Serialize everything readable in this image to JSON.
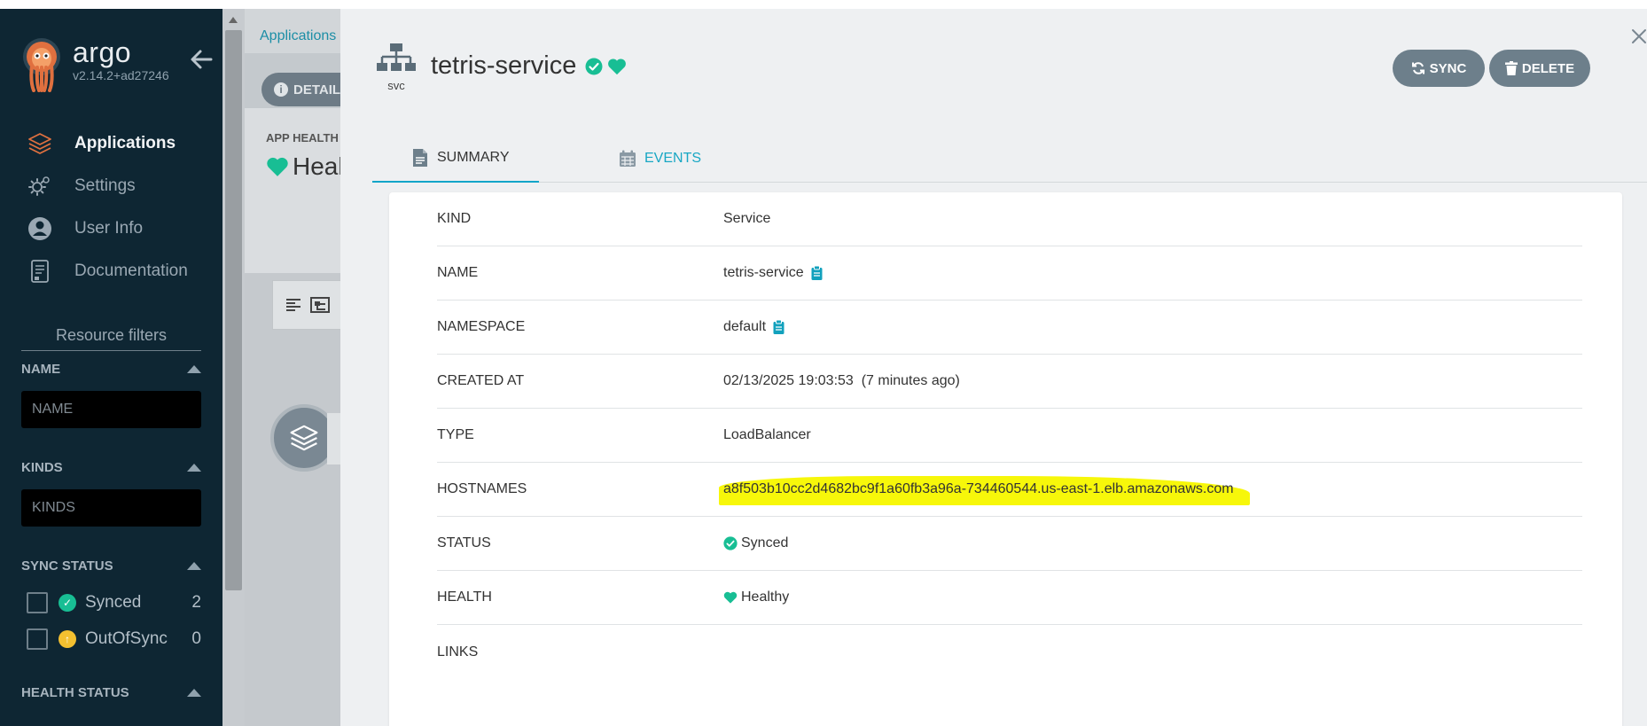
{
  "sidebar": {
    "brand_name": "argo",
    "version": "v2.14.2+ad27246",
    "nav": [
      {
        "label": "Applications",
        "icon": "layers-icon",
        "active": true
      },
      {
        "label": "Settings",
        "icon": "gear-icon"
      },
      {
        "label": "User Info",
        "icon": "user-icon"
      },
      {
        "label": "Documentation",
        "icon": "document-icon"
      }
    ],
    "resource_filters_title": "Resource filters",
    "name_filter": {
      "label": "NAME",
      "placeholder": "NAME"
    },
    "kinds_filter": {
      "label": "KINDS",
      "placeholder": "KINDS"
    },
    "sync_status": {
      "label": "SYNC STATUS",
      "items": [
        {
          "label": "Synced",
          "count": "2",
          "color": "#18be94"
        },
        {
          "label": "OutOfSync",
          "count": "0",
          "color": "#f4c030"
        }
      ]
    },
    "health_status": {
      "label": "HEALTH STATUS"
    }
  },
  "background": {
    "breadcrumb": "Applications",
    "details_button": "DETAILS",
    "app_health_label": "APP HEALTH",
    "app_health_value": "Healthy"
  },
  "panel": {
    "resource_kind_short": "svc",
    "title": "tetris-service",
    "sync_button": "SYNC",
    "delete_button": "DELETE",
    "tabs": [
      {
        "label": "SUMMARY",
        "icon": "file-icon",
        "active": true
      },
      {
        "label": "EVENTS",
        "icon": "calendar-icon"
      }
    ],
    "summary": {
      "kind": {
        "key": "KIND",
        "value": "Service"
      },
      "name": {
        "key": "NAME",
        "value": "tetris-service"
      },
      "namespace": {
        "key": "NAMESPACE",
        "value": "default"
      },
      "created_at": {
        "key": "CREATED AT",
        "value": "02/13/2025 19:03:53  (7 minutes ago)"
      },
      "type": {
        "key": "TYPE",
        "value": "LoadBalancer"
      },
      "hostnames": {
        "key": "HOSTNAMES",
        "value": "a8f503b10cc2d4682bc9f1a60fb3a96a-734460544.us-east-1.elb.amazonaws.com"
      },
      "status": {
        "key": "STATUS",
        "value": "Synced"
      },
      "health": {
        "key": "HEALTH",
        "value": "Healthy"
      },
      "links": {
        "key": "LINKS",
        "value": ""
      }
    }
  },
  "colors": {
    "sidebar_bg": "#0e2633",
    "accent_teal": "#18a7c4",
    "synced_green": "#18be94",
    "outofsync_yellow": "#f4c030",
    "button_gray": "#6d7f8b",
    "highlight_yellow": "#f7f70a"
  }
}
